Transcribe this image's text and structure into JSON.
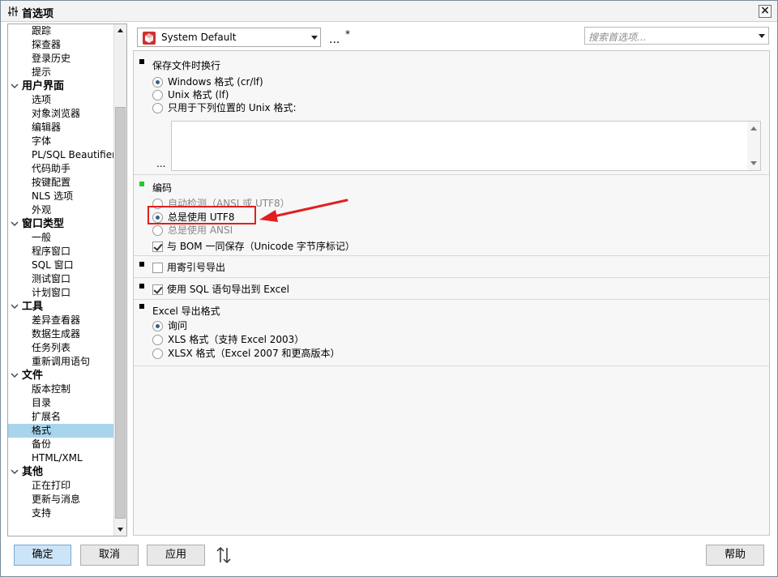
{
  "window": {
    "title": "首选项"
  },
  "tree": {
    "items": [
      {
        "label": "跟踪",
        "type": "child"
      },
      {
        "label": "探查器",
        "type": "child"
      },
      {
        "label": "登录历史",
        "type": "child"
      },
      {
        "label": "提示",
        "type": "child"
      },
      {
        "label": "用户界面",
        "type": "cat"
      },
      {
        "label": "选项",
        "type": "child"
      },
      {
        "label": "对象浏览器",
        "type": "child"
      },
      {
        "label": "编辑器",
        "type": "child"
      },
      {
        "label": "字体",
        "type": "child"
      },
      {
        "label": "PL/SQL Beautifier",
        "type": "child"
      },
      {
        "label": "代码助手",
        "type": "child"
      },
      {
        "label": "按键配置",
        "type": "child"
      },
      {
        "label": "NLS 选项",
        "type": "child"
      },
      {
        "label": "外观",
        "type": "child"
      },
      {
        "label": "窗口类型",
        "type": "cat"
      },
      {
        "label": "一般",
        "type": "child"
      },
      {
        "label": "程序窗口",
        "type": "child"
      },
      {
        "label": "SQL 窗口",
        "type": "child"
      },
      {
        "label": "测试窗口",
        "type": "child"
      },
      {
        "label": "计划窗口",
        "type": "child"
      },
      {
        "label": "工具",
        "type": "cat"
      },
      {
        "label": "差异查看器",
        "type": "child"
      },
      {
        "label": "数据生成器",
        "type": "child"
      },
      {
        "label": "任务列表",
        "type": "child"
      },
      {
        "label": "重新调用语句",
        "type": "child"
      },
      {
        "label": "文件",
        "type": "cat"
      },
      {
        "label": "版本控制",
        "type": "child"
      },
      {
        "label": "目录",
        "type": "child"
      },
      {
        "label": "扩展名",
        "type": "child"
      },
      {
        "label": "格式",
        "type": "child",
        "selected": true
      },
      {
        "label": "备份",
        "type": "child"
      },
      {
        "label": "HTML/XML",
        "type": "child"
      },
      {
        "label": "其他",
        "type": "cat"
      },
      {
        "label": "正在打印",
        "type": "child"
      },
      {
        "label": "更新与消息",
        "type": "child"
      },
      {
        "label": "支持",
        "type": "child"
      }
    ]
  },
  "toolbar": {
    "scheme_value": "System Default",
    "more_label": "...",
    "modified_mark": "*",
    "search_placeholder": "搜索首选项..."
  },
  "sections": {
    "line_endings": {
      "title": "保存文件时换行",
      "options": [
        "Windows 格式 (cr/lf)",
        "Unix 格式 (lf)",
        "只用于下列位置的 Unix 格式:"
      ],
      "selected": 0,
      "dots": "..."
    },
    "encoding": {
      "title": "编码",
      "options": [
        "自动检测（ANSI 或 UTF8）",
        "总是使用 UTF8",
        "总是使用 ANSI"
      ],
      "selected": 1,
      "bom_label": "与 BOM 一同保存（Unicode 字节序标记）",
      "bom_checked": true
    },
    "quote_export": {
      "label": "用寄引号导出",
      "checked": false
    },
    "sql_export": {
      "label": "使用 SQL 语句导出到 Excel",
      "checked": true
    },
    "excel_format": {
      "title": "Excel 导出格式",
      "options": [
        "询问",
        "XLS 格式（支持 Excel 2003）",
        "XLSX 格式（Excel 2007 和更高版本）"
      ],
      "selected": 0
    }
  },
  "buttons": {
    "ok": "确定",
    "cancel": "取消",
    "apply": "应用",
    "help": "帮助"
  },
  "colors": {
    "selected_row": "#a8d4ec",
    "highlight": "#e02020",
    "primary_button": "#cce4f7"
  }
}
